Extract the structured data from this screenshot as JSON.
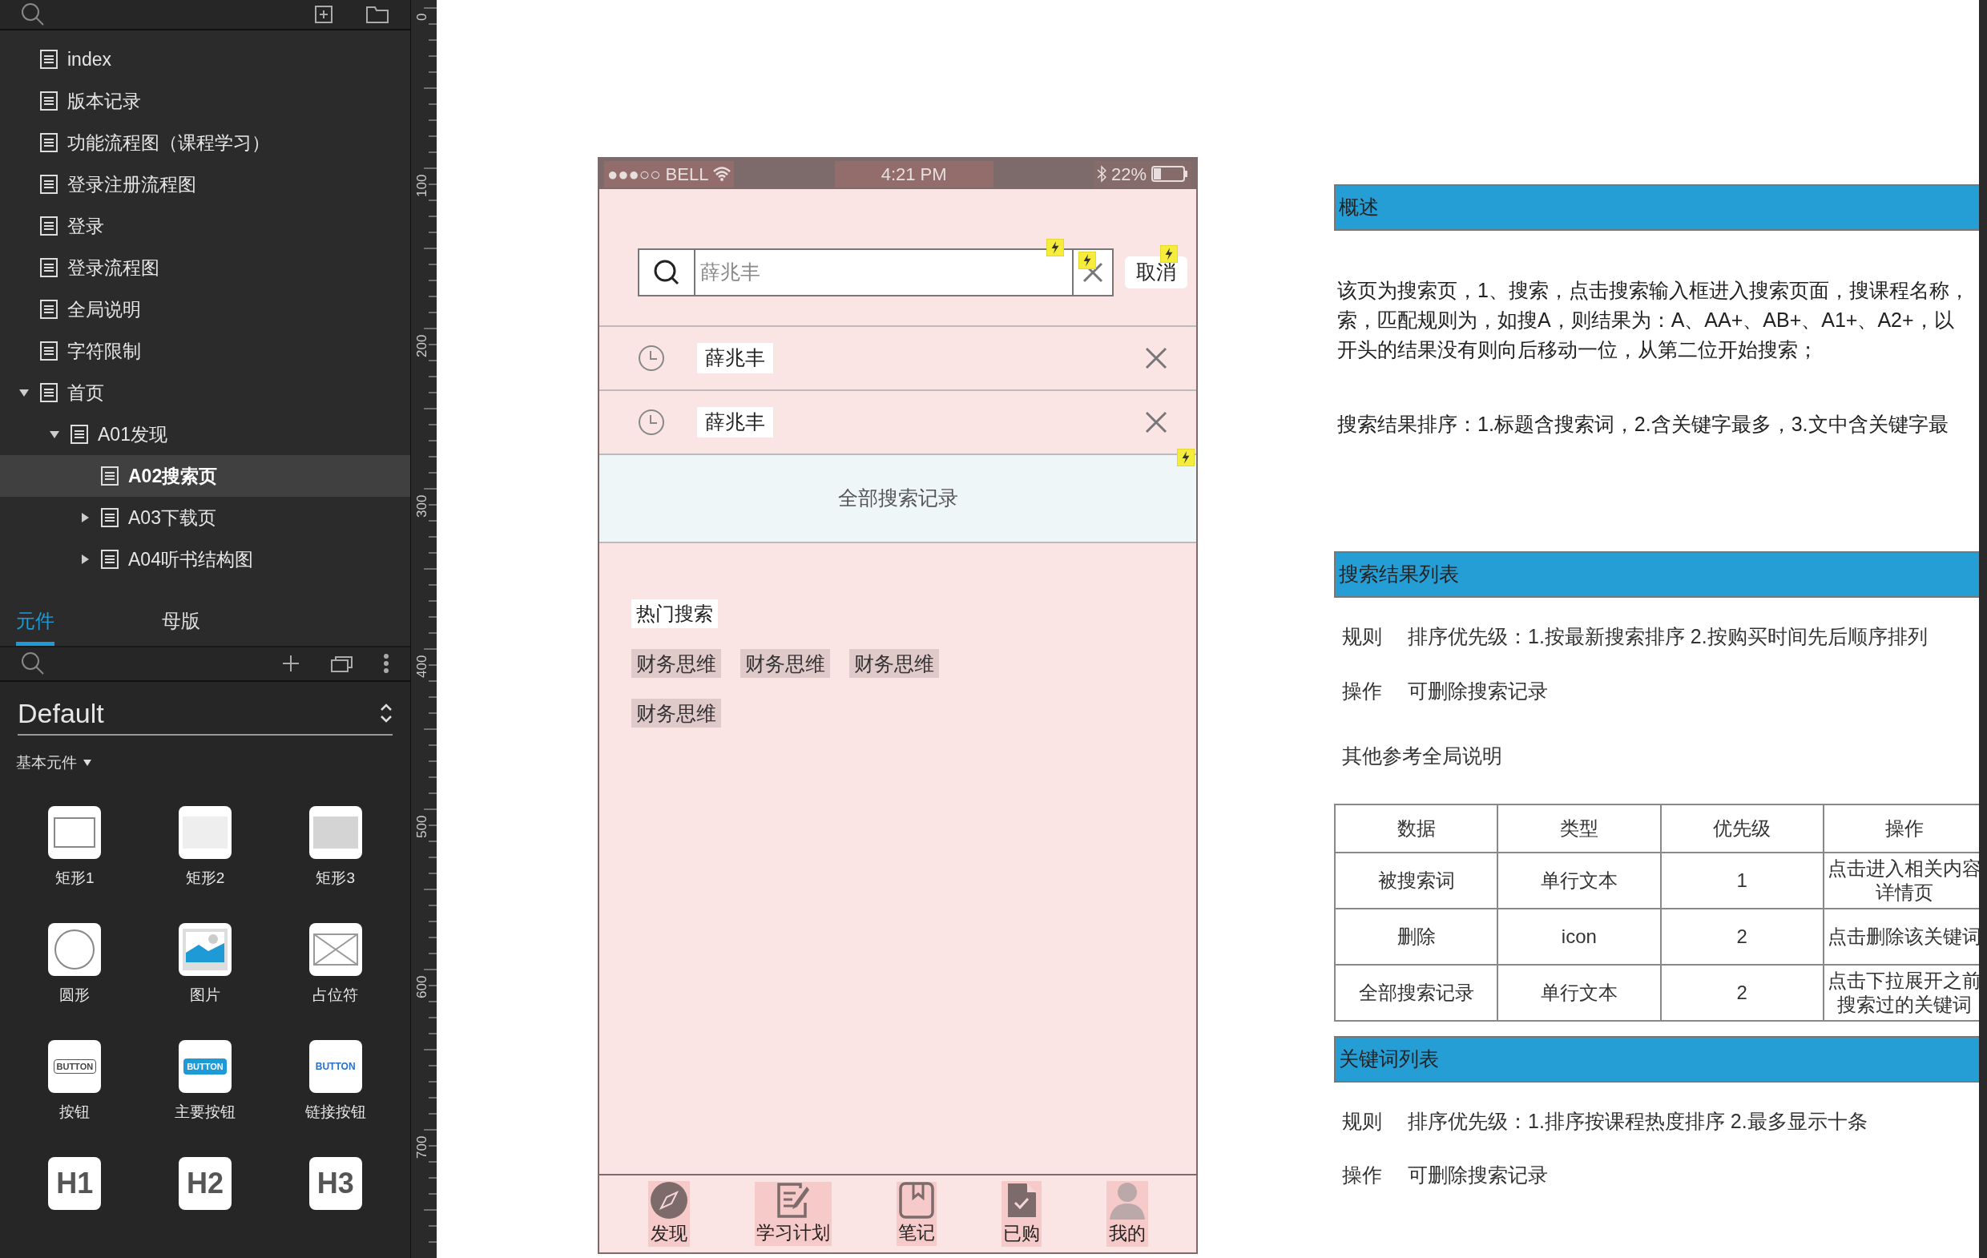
{
  "sidebar": {
    "pages": [
      {
        "label": "index",
        "selected": false
      },
      {
        "label": "版本记录",
        "selected": false
      },
      {
        "label": "功能流程图（课程学习）",
        "selected": false
      },
      {
        "label": "登录注册流程图",
        "selected": false
      },
      {
        "label": "登录",
        "selected": false
      },
      {
        "label": "登录流程图",
        "selected": false
      },
      {
        "label": "全局说明",
        "selected": false
      },
      {
        "label": "字符限制",
        "selected": false
      },
      {
        "label": "首页",
        "selected": false,
        "expanded": true,
        "children": [
          {
            "label": "A01发现",
            "selected": false,
            "expanded": true,
            "children": [
              {
                "label": "A02搜索页",
                "selected": true
              },
              {
                "label": "A03下载页",
                "selected": false,
                "expanded": false
              },
              {
                "label": "A04听书结构图",
                "selected": false,
                "expanded": false
              }
            ]
          }
        ]
      }
    ],
    "library_tabs": [
      {
        "label": "元件",
        "selected": true
      },
      {
        "label": "母版",
        "selected": false
      }
    ],
    "library": "Default",
    "group": "基本元件",
    "widgets": [
      {
        "kind": "rect1",
        "label": "矩形1"
      },
      {
        "kind": "rect2",
        "label": "矩形2"
      },
      {
        "kind": "rect3",
        "label": "矩形3"
      },
      {
        "kind": "circle",
        "label": "圆形"
      },
      {
        "kind": "image",
        "label": "图片"
      },
      {
        "kind": "placeholder",
        "label": "占位符"
      },
      {
        "kind": "button",
        "label": "按钮",
        "glyph": "BUTTON"
      },
      {
        "kind": "primary",
        "label": "主要按钮",
        "glyph": "BUTTON"
      },
      {
        "kind": "link",
        "label": "链接按钮",
        "glyph": "BUTTON"
      },
      {
        "kind": "heading",
        "glyph": "H1"
      },
      {
        "kind": "heading",
        "glyph": "H2"
      },
      {
        "kind": "heading",
        "glyph": "H3"
      }
    ]
  },
  "ruler": [
    "0",
    "100",
    "200",
    "300",
    "400",
    "500",
    "600",
    "700"
  ],
  "phone": {
    "status": {
      "carrier": "●●●○○ BELL",
      "time": "4:21 PM",
      "battery": "22%"
    },
    "search": {
      "placeholder": "薛兆丰",
      "cancel": "取消"
    },
    "history": [
      "薛兆丰",
      "薛兆丰"
    ],
    "all_history": "全部搜索记录",
    "hot_title": "热门搜索",
    "hot_tags": [
      "财务思维",
      "财务思维",
      "财务思维",
      "财务思维"
    ],
    "tabs": [
      {
        "kind": "compass",
        "label": "发现"
      },
      {
        "kind": "edit",
        "label": "学习计划"
      },
      {
        "kind": "bookmark",
        "label": "笔记"
      },
      {
        "kind": "file",
        "label": "已购"
      },
      {
        "kind": "person",
        "label": "我的"
      }
    ]
  },
  "doc": {
    "sections": [
      {
        "title": "概述",
        "blocks": [
          {
            "kind": "paragraph",
            "lines": [
              "该页为搜索页，1、搜索，点击搜索输入框进入搜索页面，搜课程名称，",
              "索，匹配规则为，如搜A，则结果为：A、AA+、AB+、A1+、A2+，以",
              "开头的结果没有则向后移动一位，从第二位开始搜索；"
            ]
          },
          {
            "kind": "paragraph",
            "lines": [
              "搜索结果排序：1.标题含搜索词，2.含关键字最多，3.文中含关键字最"
            ]
          }
        ]
      },
      {
        "title": "搜索结果列表",
        "blocks": [
          {
            "kind": "rule",
            "term": "规则",
            "text": "排序优先级：1.按最新搜索排序   2.按购买时间先后顺序排列"
          },
          {
            "kind": "rule",
            "term": "操作",
            "text": "可删除搜索记录"
          },
          {
            "kind": "note",
            "text": "其他参考全局说明"
          },
          {
            "kind": "table",
            "columns": [
              "数据",
              "类型",
              "优先级",
              "操作"
            ],
            "rows": [
              [
                "被搜索词",
                "单行文本",
                "1",
                "点击进入相关内容详情页"
              ],
              [
                "删除",
                "icon",
                "2",
                "点击删除该关键词"
              ],
              [
                "全部搜索记录",
                "单行文本",
                "2",
                "点击下拉展开之前搜索过的关键词"
              ]
            ]
          }
        ]
      },
      {
        "title": "关键词列表",
        "blocks": [
          {
            "kind": "rule",
            "term": "规则",
            "text": "排序优先级：1.排序按课程热度排序  2.最多显示十条"
          },
          {
            "kind": "rule",
            "term": "操作",
            "text": "可删除搜索记录"
          }
        ]
      }
    ]
  }
}
